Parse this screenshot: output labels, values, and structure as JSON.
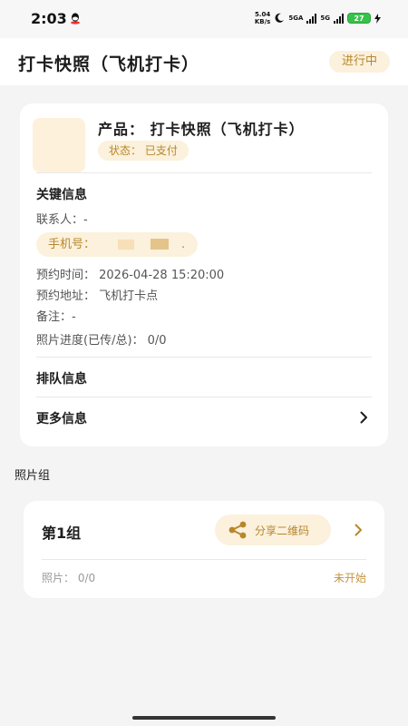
{
  "status_bar": {
    "time": "2:03",
    "speed_value": "5.04",
    "speed_unit": "KB/s",
    "net1": "5GA",
    "net2": "5G",
    "battery": "27"
  },
  "header": {
    "title": "打卡快照（飞机打卡）",
    "status_badge": "进行中"
  },
  "order_card": {
    "product": "产品：  打卡快照（飞机打卡）",
    "pay_status": "状态：  已支付",
    "key_info_title": "关键信息",
    "contact": "联系人：-",
    "phone_label": "手机号：",
    "phone_tail": ".",
    "appointment_time": "预约时间：  2026-04-28 15:20:00",
    "appointment_place": "预约地址：  飞机打卡点",
    "remark": "备注：-",
    "photo_progress": "照片进度(已传/总)：  0/0",
    "queue_title": "排队信息",
    "more_title": "更多信息"
  },
  "photo_group": {
    "heading": "照片组",
    "group_title": "第1组",
    "share_label": "分享二维码",
    "photos": "照片：  0/0",
    "status": "未开始"
  },
  "colors": {
    "accent": "#b8862b",
    "accent_bg": "#fbf1dc",
    "page_bg": "#f4f4f4"
  },
  "icons": [
    "qq-icon",
    "moon-icon",
    "signal-icon",
    "battery-icon",
    "charging-icon",
    "chevron-right-icon",
    "share-icon"
  ]
}
